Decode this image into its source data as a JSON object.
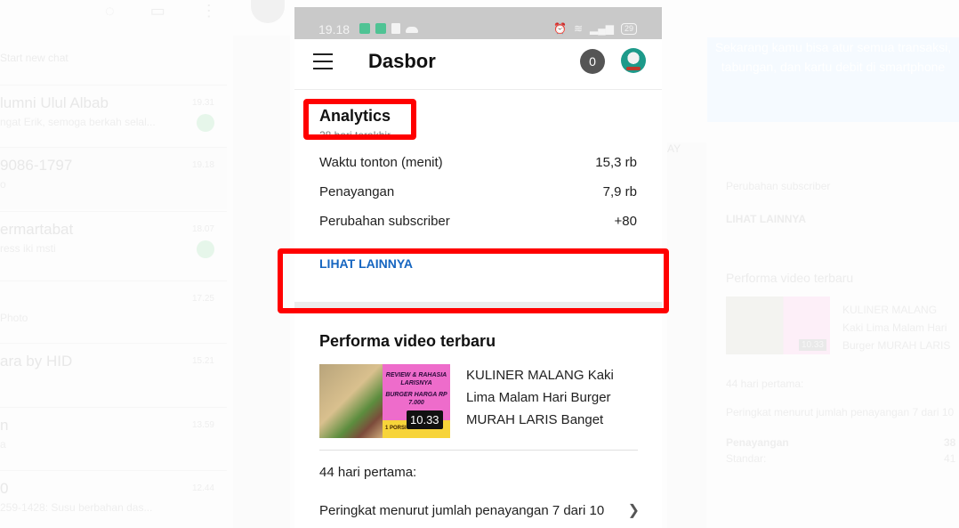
{
  "background_left": {
    "hint": "Start new chat",
    "chats": [
      {
        "name": "lumni Ulul Albab",
        "message": "ngat Erik, semoga berkah selal...",
        "time": "19.31"
      },
      {
        "name": "9086-1797",
        "message": "o",
        "time": "19.18"
      },
      {
        "name": "ermartabat",
        "message": "ress iki msti",
        "time": "18.07"
      },
      {
        "name": "",
        "message": "Photo",
        "time": "17.25"
      },
      {
        "name": "ara by HID",
        "message": "",
        "time": "15.21"
      },
      {
        "name": "n",
        "message": "a",
        "time": "13.59"
      },
      {
        "name": "0",
        "message": "259-1428: Susu berbahan das...",
        "time": "12.44"
      }
    ]
  },
  "background_right": {
    "banner": "Sekarang kamu bisa atur semua transaksi, tabungan, dan kartu debit di smartphone",
    "side_label": "AY",
    "subscriber_label": "Perubahan subscriber",
    "see_more": "LIHAT LAINNYA",
    "perf_title": "Performa video terbaru",
    "video_title": "KULINER MALANG Kaki Lima Malam Hari Burger MURAH LARIS Banget",
    "duration": "10.33",
    "first_days": "44 hari pertama:",
    "rank": "Peringkat menurut jumlah penayangan 7 dari 10",
    "views_label": "Penayangan",
    "views_value": "38",
    "standard_label": "Standar:",
    "standard_value": "41"
  },
  "statusbar": {
    "time": "19.18",
    "battery": "29"
  },
  "appbar": {
    "title": "Dasbor",
    "notification_count": "0"
  },
  "analytics": {
    "title": "Analytics",
    "period": "28 hari terakhir",
    "metrics": [
      {
        "label": "Waktu tonton (menit)",
        "value": "15,3 rb"
      },
      {
        "label": "Penayangan",
        "value": "7,9 rb"
      },
      {
        "label": "Perubahan subscriber",
        "value": "+80"
      }
    ],
    "see_more": "LIHAT LAINNYA"
  },
  "performance": {
    "title": "Performa video terbaru",
    "video": {
      "title": "KULINER MALANG Kaki Lima Malam Hari Burger MURAH LARIS Banget",
      "duration": "10.33",
      "thumb_text_1": "REVIEW & RAHASIA LARISNYA",
      "thumb_text_2": "BURGER HARGA RP 7.000",
      "thumb_text_3": "1 PORSI"
    },
    "first_days": "44 hari pertama:",
    "rank": "Peringkat menurut jumlah penayangan 7 dari 10"
  },
  "colors": {
    "link": "#1565c0",
    "highlight": "#ff0000",
    "statusbar": "#c9c9c9"
  }
}
